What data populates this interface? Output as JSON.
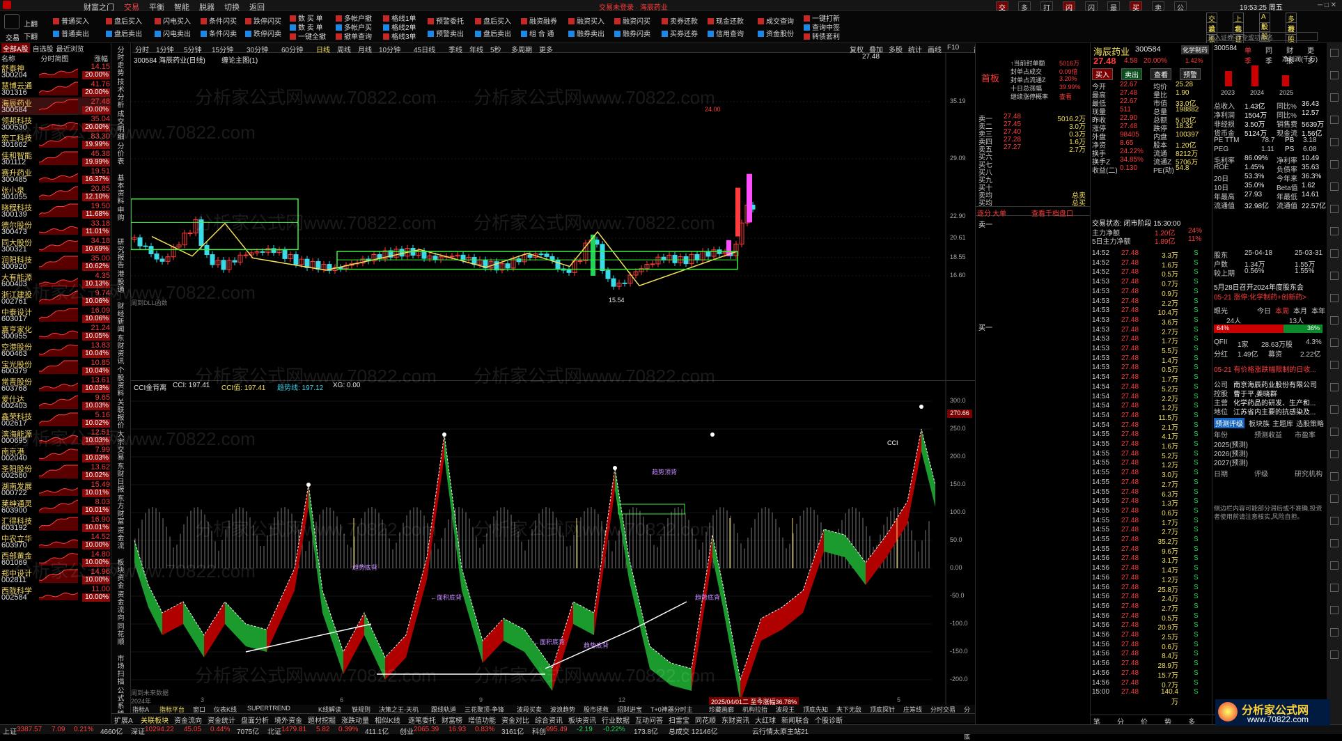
{
  "titlebar": {
    "menus": [
      "财富之门",
      "交易",
      "平衡",
      "智能",
      "脱器",
      "切换",
      "返回"
    ],
    "active": "交易",
    "center": "交易未登录 · 海辰药业",
    "time": "19:53:25 周五",
    "right_btns": [
      "交易",
      "多号盘",
      "打赏",
      "闪买",
      "闪卖",
      "最单",
      "买入",
      "卖出",
      "公式"
    ]
  },
  "toolbar": {
    "left_btns": [
      "交易",
      "上翻",
      "下翻"
    ],
    "cols": [
      [
        "普通买入",
        "普通卖出"
      ],
      [
        "盘后买入",
        "盘后卖出"
      ],
      [
        "闪电买入",
        "闪电卖出"
      ],
      [
        "条件闪买",
        "条件闪卖"
      ],
      [
        "跌停闪买",
        "跌停闪卖"
      ],
      [
        "数 买 单",
        "数 卖 单",
        "一键全撤"
      ],
      [
        "多帐户撤",
        "多帐户买",
        "撤单查询"
      ],
      [
        "格线1单",
        "格线2单",
        "格线3单"
      ],
      [
        "预警委托",
        "预警卖出"
      ],
      [
        "盘后买入",
        "盘后卖出"
      ],
      [
        "融资融券",
        "组 合 通"
      ],
      [
        "融资买入",
        "融券卖出"
      ],
      [
        "融资闪买",
        "融券闪卖"
      ],
      [
        "卖券还款",
        "买券还券"
      ],
      [
        "现金还款",
        "信用查询"
      ],
      [
        "成交查询",
        "资金股份"
      ],
      [
        "一键打新",
        "查询中签",
        "转债套利"
      ]
    ],
    "right": {
      "tabs": [
        "交易",
        "上指",
        "A股",
        "多板"
      ],
      "tabs2": [
        "设板",
        "北证",
        "B股",
        "港股"
      ],
      "search": "输入证券-命令或功能名"
    }
  },
  "chart": {
    "title": "300584 海辰药业(日线)",
    "subtitle": "缠论主图(1)",
    "tabs": [
      "分时",
      "1分钟",
      "5分钟",
      "15分钟",
      "30分钟",
      "60分钟",
      "日线",
      "周线",
      "月线",
      "10分钟",
      "45日线",
      "季线",
      "年线",
      "5秒",
      "多周期",
      "更多"
    ],
    "tabs_right": [
      "复权",
      "叠加",
      "多股",
      "统计",
      "画线",
      "F10",
      "简看",
      "标记",
      "+自选",
      "返回"
    ],
    "labels": {
      "top": "27.48",
      "hi": "24.00",
      "lo": "15.54",
      "ctrl": "周到DLL函数"
    },
    "axis": [
      "35.19",
      "29.09",
      "22.90",
      "20.61",
      "18.55",
      "16.60"
    ]
  },
  "sub": {
    "title": "CCI金背离",
    "cci": "CCI: 197.41",
    "cci2": "CCI值: 197.41",
    "trend": "趋势线: 197.12",
    "xg": "XG: 0.00",
    "ann": [
      "←面积底背",
      "趋势底背",
      "←面积底背",
      "趋势底背",
      "趋势顶背",
      "趋势底背",
      "CCI"
    ],
    "axis": [
      "300.0",
      "250.0",
      "200.0",
      "150.0",
      "100.0",
      "50.0",
      "0.00",
      "-50.0",
      "-100.0",
      "-150.0",
      "-200.0"
    ],
    "last": "270.66",
    "bottom_left": "周到未来数据",
    "date": "2025/04/01二 至今涨幅36.78%",
    "x_ticks": [
      "2024年",
      "3",
      "",
      "6",
      "",
      "9",
      "",
      "12",
      "",
      "3",
      "",
      "5"
    ]
  },
  "list": {
    "tabs": [
      "全部A股",
      "自选股",
      "最近浏览"
    ],
    "cols": [
      "名称",
      "分时简图",
      "涨幅"
    ],
    "items": [
      [
        "舒泰神",
        "300204",
        "14.15",
        "20.00%"
      ],
      [
        "慧博云通",
        "301316",
        "41.76",
        "20.00%"
      ],
      [
        "海辰药业",
        "300584",
        "27.48",
        "20.00%"
      ],
      [
        "领邦科技",
        "300530",
        "35.04",
        "20.00%"
      ],
      [
        "宏工科技",
        "301662",
        "83.30",
        "19.99%"
      ],
      [
        "佳和智能",
        "301112",
        "45.38",
        "19.99%"
      ],
      [
        "赛升药业",
        "300485",
        "19.51",
        "16.37%"
      ],
      [
        "张小泉",
        "301055",
        "20.85",
        "12.10%"
      ],
      [
        "晓程科技",
        "300139",
        "19.50",
        "11.68%"
      ],
      [
        "德尔股份",
        "300473",
        "33.18",
        "11.01%"
      ],
      [
        "同大股份",
        "300321",
        "34.18",
        "10.69%"
      ],
      [
        "润阳科技",
        "300920",
        "35.00",
        "10.62%"
      ],
      [
        "大有能源",
        "600403",
        "4.35",
        "10.13%"
      ],
      [
        "浙江建投",
        "002761",
        "9.74",
        "10.06%"
      ],
      [
        "中泰设计",
        "603017",
        "16.09",
        "10.06%"
      ],
      [
        "嘉亨家化",
        "300955",
        "21.24",
        "10.05%"
      ],
      [
        "空港股份",
        "600463",
        "13.83",
        "10.04%"
      ],
      [
        "宝光股份",
        "600379",
        "10.85",
        "10.04%"
      ],
      [
        "常青股份",
        "603768",
        "13.61",
        "10.03%"
      ],
      [
        "爱仕达",
        "002403",
        "9.65",
        "10.03%"
      ],
      [
        "鑫荣科技",
        "002617",
        "5.16",
        "10.02%"
      ],
      [
        "滨海能源",
        "000695",
        "12.51",
        "10.03%"
      ],
      [
        "南京港",
        "002040",
        "7.99",
        "10.03%"
      ],
      [
        "圣阳股份",
        "002580",
        "13.62",
        "10.02%"
      ],
      [
        "湖南发展",
        "000722",
        "15.49",
        "10.01%"
      ],
      [
        "莱绅通灵",
        "603900",
        "8.03",
        "10.01%"
      ],
      [
        "汇得科技",
        "603192",
        "16.90",
        "10.01%"
      ],
      [
        "中农立华",
        "603970",
        "14.52",
        "10.00%"
      ],
      [
        "西部黄金",
        "601069",
        "14.80",
        "10.00%"
      ],
      [
        "郑中设计",
        "002811",
        "14.96",
        "10.00%"
      ],
      [
        "西陇科学",
        "002584",
        "11.00",
        "10.00%"
      ]
    ]
  },
  "vtabs": [
    "分时走势",
    "技术分析",
    "成交明细",
    "分价表",
    "基本资料",
    "申购",
    "研究报告",
    "港股通",
    "财经新闻",
    "东财资讯",
    "个股资料",
    "关联报价",
    "大宗交易",
    "东财日报",
    "东方财富",
    "资金流",
    "板块资金",
    "资金流向",
    "同花顺",
    "市场扫描",
    "公式系统"
  ],
  "quote": {
    "name": "海辰药业",
    "code": "300584",
    "tag": "化学制药",
    "price": "27.48",
    "chg": "4.58",
    "pct": "20.00%",
    "rate": "1.42%",
    "actions": [
      "买入",
      "卖出",
      "查看",
      "预警"
    ],
    "top_label": "首板",
    "info": [
      [
        "↑当前封单额",
        "5016万"
      ],
      [
        "封单占成交",
        "0.09倍"
      ],
      [
        "封单占流通Z",
        "3.20%"
      ],
      [
        "十日总涨幅",
        "39.99%"
      ],
      [
        "继续涨停概率",
        "查看"
      ]
    ],
    "book": [
      [
        "卖一",
        "27.48",
        "5016.2万"
      ],
      [
        "卖二",
        "27.45",
        "3.0万"
      ],
      [
        "卖三",
        "27.40",
        "0.3万"
      ],
      [
        "卖四",
        "27.28",
        "1.6万"
      ],
      [
        "卖五",
        "27.27",
        "2.7万"
      ],
      [
        "买六",
        ""
      ],
      [
        "买七",
        ""
      ],
      [
        "买八",
        ""
      ],
      [
        "买九",
        ""
      ],
      [
        "买十",
        ""
      ],
      [
        "卖均",
        "",
        "总卖"
      ],
      [
        "买均",
        "",
        "总买"
      ]
    ],
    "bottom": [
      "逐分",
      "大单",
      "查看千档盘口"
    ],
    "sell1": "卖一",
    "buy1": "买一"
  },
  "detail": {
    "stats": [
      [
        "今开",
        "22.67",
        "均价",
        "25.28"
      ],
      [
        "最高",
        "27.48",
        "量比",
        "1.90"
      ],
      [
        "最低",
        "22.67",
        "市值",
        "33.0亿"
      ],
      [
        "现量",
        "511",
        "总量",
        "198882"
      ],
      [
        "昨收",
        "22.90",
        "总额",
        "5.03亿"
      ],
      [
        "涨停",
        "27.48",
        "跌停",
        "18.32"
      ],
      [
        "外盘",
        "98405",
        "内盘",
        "100397"
      ],
      [
        "净资",
        "8.65",
        "股本",
        "1.20亿"
      ],
      [
        "换手",
        "24.22%",
        "流通",
        "8212万"
      ],
      [
        "换手Z",
        "34.85%",
        "流通Z",
        "5706万"
      ],
      [
        "收益(二)",
        "0.130",
        "PE(动)",
        "54.8"
      ]
    ],
    "status": "交易状态: 闭市阶段 15:30:00",
    "flows": [
      [
        "主力净额",
        "1.20亿",
        "24%"
      ],
      [
        "5日主力净额",
        "1.89亿",
        "11%"
      ]
    ],
    "ticks": [
      [
        "14:52",
        "27.48",
        "3.3万",
        "S"
      ],
      [
        "14:52",
        "27.48",
        "1.6万",
        "S"
      ],
      [
        "14:52",
        "27.48",
        "0.5万",
        "S"
      ],
      [
        "14:53",
        "27.48",
        "0.7万",
        "S"
      ],
      [
        "14:53",
        "27.48",
        "0.9万",
        "S"
      ],
      [
        "14:53",
        "27.48",
        "2.2万",
        "S"
      ],
      [
        "14:53",
        "27.48",
        "10.4万",
        "S"
      ],
      [
        "14:53",
        "27.48",
        "3.6万",
        "S"
      ],
      [
        "14:53",
        "27.48",
        "2.7万",
        "S"
      ],
      [
        "14:53",
        "27.48",
        "1.7万",
        "S"
      ],
      [
        "14:53",
        "27.48",
        "5.5万",
        "S"
      ],
      [
        "14:53",
        "27.48",
        "1.4万",
        "S"
      ],
      [
        "14:53",
        "27.48",
        "0.5万",
        "S"
      ],
      [
        "14:54",
        "27.48",
        "1.7万",
        "S"
      ],
      [
        "14:54",
        "27.48",
        "5.2万",
        "S"
      ],
      [
        "14:54",
        "27.48",
        "2.2万",
        "S"
      ],
      [
        "14:54",
        "27.48",
        "1.2万",
        "S"
      ],
      [
        "14:54",
        "27.48",
        "11.5万",
        "S"
      ],
      [
        "14:54",
        "27.48",
        "2.1万",
        "S"
      ],
      [
        "14:55",
        "27.48",
        "4.1万",
        "S"
      ],
      [
        "14:55",
        "27.48",
        "1.6万",
        "S"
      ],
      [
        "14:55",
        "27.48",
        "5.2万",
        "S"
      ],
      [
        "14:55",
        "27.48",
        "1.2万",
        "S"
      ],
      [
        "14:55",
        "27.48",
        "3.0万",
        "S"
      ],
      [
        "14:55",
        "27.48",
        "2.7万",
        "S"
      ],
      [
        "14:55",
        "27.48",
        "6.3万",
        "S"
      ],
      [
        "14:55",
        "27.48",
        "1.3万",
        "S"
      ],
      [
        "14:55",
        "27.48",
        "0.6万",
        "S"
      ],
      [
        "14:55",
        "27.48",
        "1.7万",
        "S"
      ],
      [
        "14:55",
        "27.48",
        "2.7万",
        "S"
      ],
      [
        "14:55",
        "27.48",
        "35.2万",
        "S"
      ],
      [
        "14:55",
        "27.48",
        "9.6万",
        "S"
      ],
      [
        "14:56",
        "27.48",
        "3.1万",
        "S"
      ],
      [
        "14:56",
        "27.48",
        "1.4万",
        "S"
      ],
      [
        "14:56",
        "27.48",
        "1.2万",
        "S"
      ],
      [
        "14:56",
        "27.48",
        "25.8万",
        "S"
      ],
      [
        "14:56",
        "27.48",
        "2.4万",
        "S"
      ],
      [
        "14:56",
        "27.48",
        "2.7万",
        "S"
      ],
      [
        "14:56",
        "27.48",
        "0.5万",
        "S"
      ],
      [
        "14:56",
        "27.48",
        "20.9万",
        "S"
      ],
      [
        "14:56",
        "27.48",
        "2.5万",
        "S"
      ],
      [
        "14:56",
        "27.48",
        "0.6万",
        "S"
      ],
      [
        "14:56",
        "27.48",
        "8.4万",
        "S"
      ],
      [
        "14:56",
        "27.48",
        "28.9万",
        "S"
      ],
      [
        "14:56",
        "27.48",
        "15.7万",
        "S"
      ],
      [
        "14:56",
        "27.48",
        "0.7万",
        "S"
      ],
      [
        "15:00",
        "27.48",
        "140.4万",
        "S"
      ]
    ],
    "tabs": [
      "笔",
      "分",
      "价",
      "势",
      "多"
    ]
  },
  "right": {
    "code": "300584",
    "nav": [
      "单季",
      "同季",
      "财报",
      "更多"
    ],
    "metric": "净利润(千万)",
    "years": [
      "2023",
      "2024",
      "2025"
    ],
    "fund": [
      [
        "总收入",
        "1.43亿",
        "同比%",
        "36.43"
      ],
      [
        "净利润",
        "1504万",
        "同比%",
        "12.57"
      ],
      [
        "非经损",
        "3.50万",
        "销售费",
        "5639万"
      ],
      [
        "货币金",
        "5124万",
        "现金流",
        "1.56亿"
      ],
      [
        "PE TTM",
        "",
        "78.7",
        "PB",
        "3.18"
      ],
      [
        "PEG",
        "",
        "1.11",
        "PS",
        "6.08"
      ],
      [
        "毛利率",
        "86.09%",
        "净利率",
        "10.49"
      ],
      [
        "ROE",
        "1.45%",
        "负债率",
        "35.63"
      ],
      [
        "20日",
        "53.3%",
        "今年来",
        "36.3%"
      ],
      [
        "10日",
        "35.0%",
        "Beta值",
        "1.62"
      ],
      [
        "年最高",
        "27.93",
        "年最低",
        "14.61"
      ],
      [
        "流通值",
        "32.98亿",
        "流通值",
        "22.57亿"
      ]
    ],
    "holders": [
      [
        "股东",
        "25-04-18",
        "",
        "25-03-31"
      ],
      [
        "户数",
        "1.34万",
        "",
        "1.55万"
      ],
      [
        "较上期",
        "0.56%",
        "",
        "1.55%"
      ]
    ],
    "news": [
      "5月28日召开2024年度股东会",
      "05-21 涨停:化学制药+创新药>"
    ],
    "pop": {
      "tabs": [
        "今日",
        "本周",
        "本月",
        "本年"
      ],
      "label": "眼光",
      "n1": "24人",
      "n2": "13人",
      "p1": "64%",
      "p2": "36%"
    },
    "qfii": [
      "QFII",
      "1家",
      "28.63万股",
      "4.3%"
    ],
    "div": [
      "分红",
      "1.49亿",
      "募资",
      "2.22亿"
    ],
    "event": "05-21 有价格涨跌幅限制的日收...",
    "company": [
      [
        "公司",
        "南京海辰药业股份有限公司"
      ],
      [
        "控股",
        "曹于平,姜晓群"
      ],
      [
        "主营",
        "化学药品的研发、生产和..."
      ],
      [
        "地位",
        "江苏省内主要的抗感染及..."
      ]
    ],
    "forecast": {
      "title": "预测评级",
      "sub": [
        "板块族",
        "主题库",
        "选股策略"
      ],
      "cols": [
        "年份",
        "预测收益",
        "市盈率"
      ],
      "rows": [
        "2025(预测)",
        "2026(预测)",
        "2027(预测)"
      ],
      "cols2": [
        "日期",
        "评级",
        "研究机构"
      ]
    },
    "notice": "侧边栏内容可能部分滞后或不准确,投资者使用前请注意核实,风险自担。",
    "bottom": [
      "队列",
      "分布",
      "龙虎"
    ]
  },
  "bottom_tabs": [
    "扩展A",
    "关联板块",
    "资金流向",
    "资金统计",
    "盘面分析",
    "境外资金",
    "题材挖掘",
    "涨跌动量",
    "相似K线",
    "逐笔委托",
    "财富榜",
    "增值功能",
    "资金对比",
    "综合资讯",
    "板块资讯",
    "行业数据",
    "互动问答",
    "扫雷宝",
    "同花顺",
    "东财资讯",
    "大红球",
    "新闻联合",
    "个股诊断"
  ],
  "ind_tabs": [
    "指标A",
    "指标平台",
    "窗口",
    "仪表K线",
    "SUPERTREND",
    "K线解读",
    "铁规则",
    "决策之王-天机",
    "跟线轨道",
    "三花聚顶-争锋",
    "波段买卖",
    "波浪趋势",
    "股市拯救",
    "招财进宝",
    "T+0神器分时主",
    "珍藏画廊",
    "机构拉抬",
    "波段王",
    "顶底先知",
    "夹下无敌",
    "顶底探针",
    "庄筹线",
    "分时交易",
    "分时顶底"
  ],
  "status": [
    [
      "上证",
      "3387.57",
      "7.09",
      "0.21%"
    ],
    [
      "深证",
      "10294.22",
      "45.05",
      "0.44%"
    ],
    [
      "北证",
      "1479.81",
      "5.82",
      "0.39%"
    ],
    [
      "创业",
      "2065.39",
      "16.93",
      "0.83%"
    ],
    [
      "科创",
      "995.49",
      "-2.19",
      "-0.22%"
    ]
  ],
  "status_extra": [
    "4660亿",
    "7075亿",
    "411.1亿",
    "3161亿",
    "173.8亿",
    "总成交 12146亿",
    "云行情太原主站21"
  ],
  "logo": {
    "text": "分析家公式网",
    "url": "www.70822.com"
  },
  "watermark": "分析家公式网www.70822.com",
  "colors": {
    "up": "#ff3c3c",
    "down": "#22d35a",
    "bg": "#000000",
    "yellow": "#f5e05a",
    "magenta": "#ff4cff"
  }
}
